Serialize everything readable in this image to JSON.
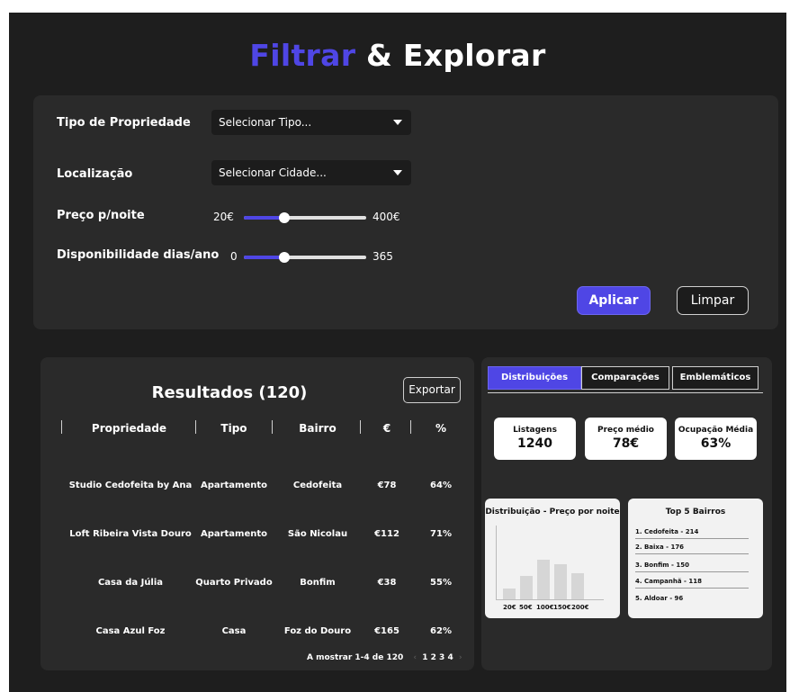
{
  "title": {
    "accent": "Filtrar",
    "rest": " & Explorar"
  },
  "filters": {
    "type_label": "Tipo de Propriedade",
    "type_value": "Selecionar Tipo...",
    "location_label": "Localização",
    "location_value": "Selecionar Cidade...",
    "price_label": "Preço p/noite",
    "price_min": "20€",
    "price_max": "400€",
    "price_level": 0.33,
    "avail_label": "Disponibilidade dias/ano",
    "avail_min": "0",
    "avail_max": "365",
    "avail_level": 0.33,
    "apply_label": "Aplicar",
    "clear_label": "Limpar"
  },
  "results": {
    "title": "Resultados (120)",
    "export_label": "Exportar",
    "columns": [
      "Propriedade",
      "Tipo",
      "Bairro",
      "€",
      "%"
    ],
    "rows": [
      [
        "Studio Cedofeita by Ana",
        "Apartamento",
        "Cedofeita",
        "€78",
        "64%"
      ],
      [
        "Loft Ribeira Vista Douro",
        "Apartamento",
        "São Nicolau",
        "€112",
        "71%"
      ],
      [
        "Casa da Júlia",
        "Quarto Privado",
        "Bonfim",
        "€38",
        "55%"
      ],
      [
        "Casa Azul Foz",
        "Casa",
        "Foz do Douro",
        "€165",
        "62%"
      ]
    ],
    "pager_text": "A mostrar 1-4 de 120",
    "pages": "1 2 3 4"
  },
  "stats": {
    "tabs": [
      "Distribuições",
      "Comparações",
      "Emblemáticos"
    ],
    "kpis": [
      {
        "label": "Listagens",
        "value": "1240"
      },
      {
        "label": "Preço médio",
        "value": "78€"
      },
      {
        "label": "Ocupação Média",
        "value": "63%"
      }
    ],
    "top5_title": "Top 5 Bairros",
    "top5": [
      "1. Cedofeita - 214",
      "2. Baixa - 176",
      "3. Bonfim - 150",
      "4. Campanhã - 118",
      "5. Aldoar - 96"
    ]
  },
  "chart_data": {
    "type": "bar",
    "title": "Distribuição - Preço por noite",
    "categories": [
      "20€",
      "50€",
      "100€",
      "150€",
      "200€"
    ],
    "values": [
      15,
      32,
      54,
      48,
      35
    ],
    "ylim": [
      0,
      100
    ],
    "color": "#d6d6d6"
  },
  "colors": {
    "accent": "#4f46e5",
    "background": "#1e1e1e",
    "panel": "#2a2a2a"
  }
}
